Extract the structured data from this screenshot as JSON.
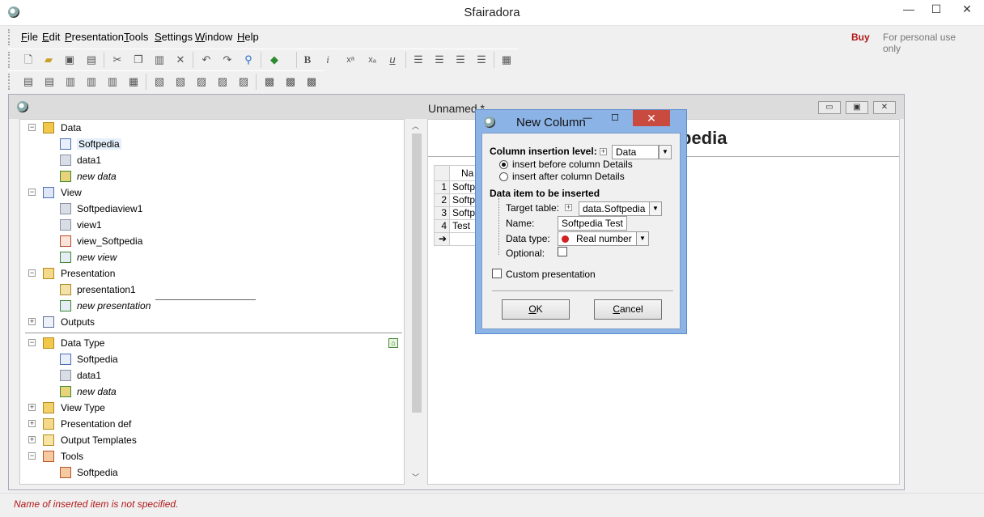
{
  "app": {
    "title": "Sfairadora"
  },
  "window_controls": {
    "minimize": "—",
    "maximize": "☐",
    "close": "✕"
  },
  "menu": {
    "items": [
      {
        "underline": "F",
        "rest": "ile"
      },
      {
        "underline": "E",
        "rest": "dit"
      },
      {
        "underline": "P",
        "rest": "resentation"
      },
      {
        "underline": "T",
        "rest": "ools"
      },
      {
        "underline": "S",
        "rest": "ettings"
      },
      {
        "underline": "W",
        "rest": "indow"
      },
      {
        "underline": "H",
        "rest": "elp"
      }
    ],
    "buy": "Buy",
    "personal": "For personal use only"
  },
  "toolbar": {
    "row1": [
      "new-doc",
      "open-folder",
      "save",
      "print",
      "cut",
      "copy",
      "paste",
      "delete",
      "undo",
      "redo",
      "find",
      "book",
      "bold",
      "italic",
      "superscript",
      "subscript",
      "underline",
      "align-left",
      "align-center",
      "align-right",
      "justify",
      "table"
    ],
    "row1_glyphs": {
      "bold": "B",
      "italic": "i",
      "superscript": "xᵃ",
      "subscript": "xₐ",
      "underline": "u"
    }
  },
  "document": {
    "title": "Unnamed *",
    "controls": {
      "minimize": "▭",
      "maximize": "▣",
      "close": "✕"
    }
  },
  "tree": {
    "items": [
      {
        "label": "Data",
        "expander": "−",
        "level": 0,
        "italic": false,
        "icon": "data-folder"
      },
      {
        "label": "Softpedia",
        "expander": "",
        "level": 1,
        "italic": false,
        "icon": "table-link",
        "selected": true
      },
      {
        "label": "data1",
        "expander": "",
        "level": 1,
        "italic": false,
        "icon": "table-gray"
      },
      {
        "label": "new data",
        "expander": "",
        "level": 1,
        "italic": true,
        "icon": "new-data"
      },
      {
        "label": "View",
        "expander": "−",
        "level": 0,
        "italic": false,
        "icon": "view-grid"
      },
      {
        "label": "Softpediaview1",
        "expander": "",
        "level": 1,
        "italic": false,
        "icon": "view-gray"
      },
      {
        "label": "view1",
        "expander": "",
        "level": 1,
        "italic": false,
        "icon": "view-gray"
      },
      {
        "label": "view_Softpedia",
        "expander": "",
        "level": 1,
        "italic": false,
        "icon": "view-link"
      },
      {
        "label": "new view",
        "expander": "",
        "level": 1,
        "italic": true,
        "icon": "new-view"
      },
      {
        "label": "Presentation",
        "expander": "−",
        "level": 0,
        "italic": false,
        "icon": "presentation"
      },
      {
        "label": "presentation1",
        "expander": "",
        "level": 1,
        "italic": false,
        "icon": "presentation-item"
      },
      {
        "label": "new presentation",
        "expander": "",
        "level": 1,
        "italic": true,
        "icon": "new-presentation"
      },
      {
        "label": "Outputs",
        "expander": "+",
        "level": 0,
        "italic": false,
        "icon": "outputs"
      },
      {
        "label": "Data Type",
        "expander": "−",
        "level": 0,
        "italic": false,
        "icon": "data-type"
      },
      {
        "label": "Softpedia",
        "expander": "",
        "level": 1,
        "italic": false,
        "icon": "table-link"
      },
      {
        "label": "data1",
        "expander": "",
        "level": 1,
        "italic": false,
        "icon": "table-gray"
      },
      {
        "label": "new data",
        "expander": "",
        "level": 1,
        "italic": true,
        "icon": "new-data"
      },
      {
        "label": "View Type",
        "expander": "+",
        "level": 0,
        "italic": false,
        "icon": "view-type"
      },
      {
        "label": "Presentation def",
        "expander": "+",
        "level": 0,
        "italic": false,
        "icon": "presentation-def"
      },
      {
        "label": "Output Templates",
        "expander": "+",
        "level": 0,
        "italic": false,
        "icon": "output-templates"
      },
      {
        "label": "Tools",
        "expander": "−",
        "level": 0,
        "italic": false,
        "icon": "tools"
      },
      {
        "label": "Softpedia",
        "expander": "",
        "level": 1,
        "italic": false,
        "icon": "tools-item"
      }
    ]
  },
  "right_panel": {
    "heading": "pedia",
    "grid": {
      "header": "Na",
      "rows": [
        {
          "num": "1",
          "value": "Softp"
        },
        {
          "num": "2",
          "value": "Softp"
        },
        {
          "num": "3",
          "value": "Softp"
        },
        {
          "num": "4",
          "value": "Test"
        },
        {
          "num": "➔",
          "value": ""
        }
      ]
    }
  },
  "dialog": {
    "title": "New Column",
    "level_label": "Column insertion level:",
    "level_value": "Data",
    "expander": "+",
    "radio_before": "insert before column Details",
    "radio_after": "insert after column Details",
    "section2": "Data item to be inserted",
    "target_label": "Target table:",
    "target_value": "data.Softpedia",
    "name_label": "Name:",
    "name_value": "Softpedia Test",
    "type_label": "Data type:",
    "type_value": "Real number",
    "optional_label": "Optional:",
    "custom_label": "Custom presentation",
    "ok": {
      "underline": "O",
      "rest": "K"
    },
    "cancel": {
      "underline": "C",
      "rest": "ancel"
    },
    "controls": {
      "minimize": "—",
      "maximize": "☐",
      "close": "✕"
    }
  },
  "status": {
    "text": "Name of inserted item is not specified."
  },
  "colors": {
    "accent_red": "#b01818",
    "dialog_frame": "#8cb3e6",
    "close_red": "#c94a3e"
  }
}
